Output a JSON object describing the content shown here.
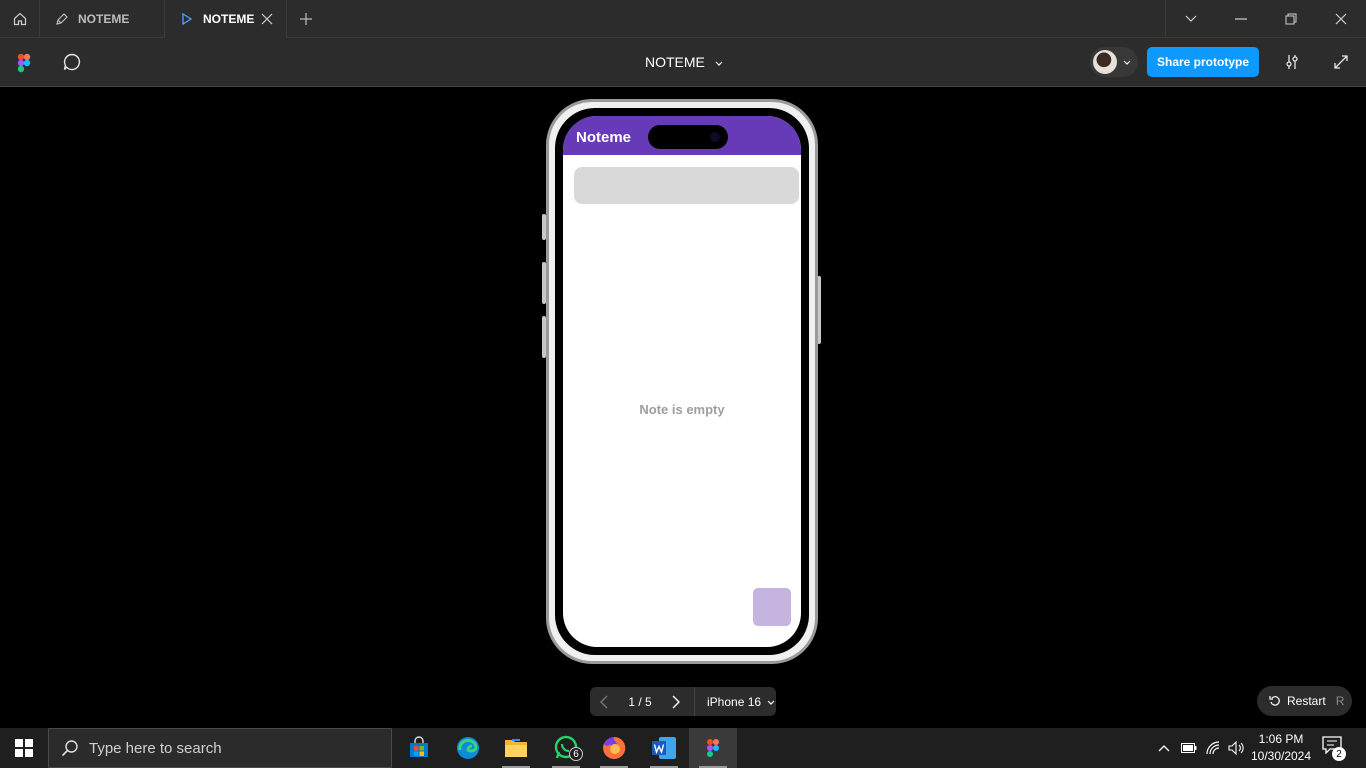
{
  "tabs": [
    {
      "label": "NOTEME",
      "icon": "pen-icon"
    },
    {
      "label": "NOTEME",
      "icon": "play-icon"
    }
  ],
  "toolbar": {
    "project_title": "NOTEME",
    "share_label": "Share prototype"
  },
  "prototype": {
    "app_title": "Noteme",
    "empty_message": "Note is empty",
    "header_color": "#673ab7",
    "fab_color": "#c5b3e0"
  },
  "pager": {
    "page_text": "1 / 5",
    "device": "iPhone 16"
  },
  "restart": {
    "label": "Restart",
    "shortcut": "R"
  },
  "taskbar": {
    "search_placeholder": "Type here to search",
    "whatsapp_badge": "6",
    "time": "1:06 PM",
    "date": "10/30/2024",
    "notification_count": "2"
  },
  "colors": {
    "accent": "#0d99ff",
    "chrome": "#2c2c2c"
  }
}
